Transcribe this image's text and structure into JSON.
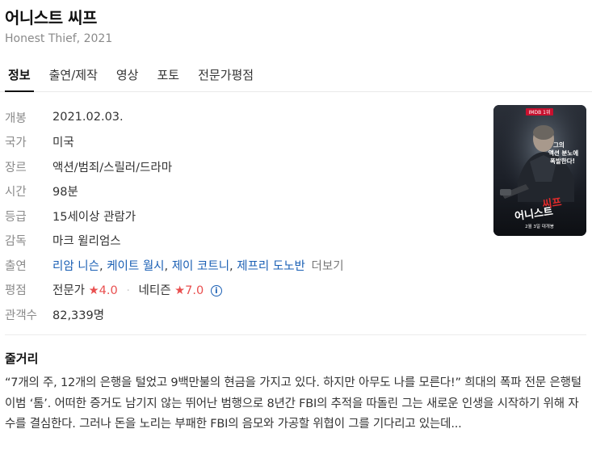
{
  "movie": {
    "title": "어니스트 씨프",
    "subtitle": "Honest Thief, 2021"
  },
  "tabs": [
    {
      "label": "정보",
      "active": true
    },
    {
      "label": "출연/제작",
      "active": false
    },
    {
      "label": "영상",
      "active": false
    },
    {
      "label": "포토",
      "active": false
    },
    {
      "label": "전문가평점",
      "active": false
    }
  ],
  "info": {
    "release_label": "개봉",
    "release": "2021.02.03.",
    "country_label": "국가",
    "country": "미국",
    "genre_label": "장르",
    "genre": "액션/범죄/스릴러/드라마",
    "runtime_label": "시간",
    "runtime": "98분",
    "rating_label": "등급",
    "rating": "15세이상 관람가",
    "director_label": "감독",
    "director": "마크 윌리엄스",
    "cast_label": "출연",
    "cast": [
      "리암 니슨",
      "케이트 월시",
      "제이 코트니",
      "제프리 도노반"
    ],
    "cast_more": "더보기",
    "score_label": "평점",
    "critic_label": "전문가",
    "critic_score": "4.0",
    "netizen_label": "네티즌",
    "netizen_score": "7.0",
    "audience_label": "관객수",
    "audience": "82,339명"
  },
  "plot": {
    "title": "줄거리",
    "text": "“7개의 주, 12개의 은행을 털었고 9백만불의 현금을 가지고 있다. 하지만 아무도 나를 모른다!” 희대의 폭파 전문 은행털이범 ‘톰’. 어떠한 증거도 남기지 않는 뛰어난 범행으로 8년간 FBI의 추적을 따돌린 그는 새로운 인생을 시작하기 위해 자수를 결심한다. 그러나 돈을 노리는 부패한 FBI의 음모와 가공할 위협이 그를 기다리고 있는데..."
  },
  "poster": {
    "tagline": "그의 액션 분노에 폭발한다!",
    "title": "어니스트 씨프",
    "date": "2월 3일 대개봉",
    "badge": "IMDB 1위"
  },
  "colors": {
    "link": "#1a5fb4",
    "star": "#e94f4f"
  }
}
